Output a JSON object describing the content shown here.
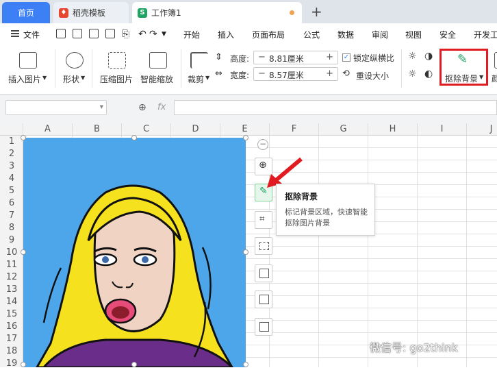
{
  "tabs": {
    "home": "首页",
    "template": "稻壳模板",
    "workbook": "工作簿1",
    "new": "+"
  },
  "menu": {
    "file": "文件",
    "items": [
      "开始",
      "插入",
      "页面布局",
      "公式",
      "数据",
      "审阅",
      "视图",
      "安全",
      "开发工"
    ]
  },
  "ribbon": {
    "insert_image": "插入图片",
    "shape": "形状",
    "compress": "压缩图片",
    "smart_scale": "智能缩放",
    "crop": "裁剪",
    "height_label": "高度:",
    "height_value": "8.81厘米",
    "width_label": "宽度:",
    "width_value": "8.57厘米",
    "lock_ratio": "锁定纵横比",
    "reset_size": "重设大小",
    "remove_bg": "抠除背景",
    "more": "颜"
  },
  "formula": {
    "fx": "fx",
    "name_value": "",
    "formula_value": ""
  },
  "columns": [
    "A",
    "B",
    "C",
    "D",
    "E",
    "F",
    "G",
    "H",
    "I",
    "J"
  ],
  "rows": [
    "1",
    "2",
    "3",
    "4",
    "5",
    "6",
    "7",
    "8",
    "9",
    "10",
    "11",
    "12",
    "13",
    "14",
    "15",
    "16",
    "17",
    "18",
    "19"
  ],
  "tooltip": {
    "title": "抠除背景",
    "desc": "标记背景区域，快速智能抠除图片背景"
  },
  "watermark": "微信号: go2think",
  "colors": {
    "accent": "#3d7ff5",
    "highlight": "#e11b22",
    "image_bg": "#4da6ea",
    "hair": "#f6e11e"
  }
}
